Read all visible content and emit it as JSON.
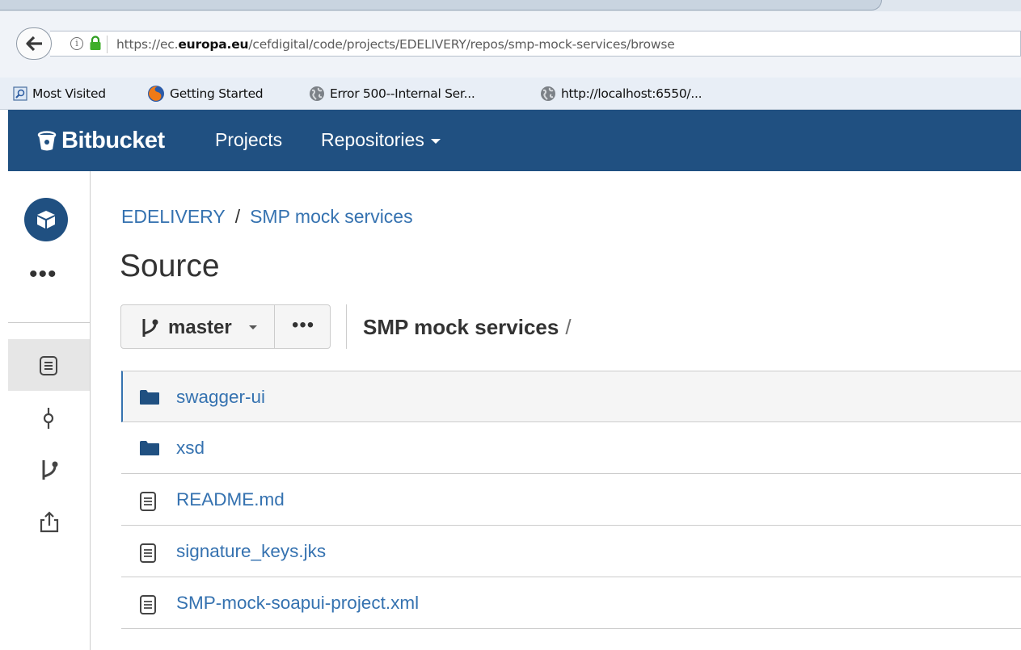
{
  "browser": {
    "url_prefix": "https://ec.",
    "url_domain": "europa.eu",
    "url_path": "/cefdigital/code/projects/EDELIVERY/repos/smp-mock-services/browse",
    "bookmarks": [
      {
        "label": "Most Visited",
        "icon": "bookmark-folder-icon"
      },
      {
        "label": "Getting Started",
        "icon": "firefox-icon"
      },
      {
        "label": "Error 500--Internal Ser...",
        "icon": "globe-icon"
      },
      {
        "label": "http://localhost:6550/...",
        "icon": "globe-icon"
      }
    ]
  },
  "header": {
    "logo": "Bitbucket",
    "nav": {
      "projects": "Projects",
      "repositories": "Repositories"
    }
  },
  "breadcrumb": {
    "project": "EDELIVERY",
    "separator": "/",
    "repo": "SMP mock services"
  },
  "page": {
    "title": "Source"
  },
  "branch": {
    "name": "master",
    "more": "•••"
  },
  "path": {
    "repo": "SMP mock services",
    "slash": "/"
  },
  "sidebar": {
    "more": "•••",
    "items": [
      {
        "name": "source",
        "icon": "source-file-icon",
        "active": true
      },
      {
        "name": "commits",
        "icon": "commit-icon"
      },
      {
        "name": "branches",
        "icon": "branch-icon"
      },
      {
        "name": "pull-requests",
        "icon": "share-upload-icon"
      }
    ]
  },
  "files": [
    {
      "name": "swagger-ui",
      "type": "folder"
    },
    {
      "name": "xsd",
      "type": "folder"
    },
    {
      "name": "README.md",
      "type": "file"
    },
    {
      "name": "signature_keys.jks",
      "type": "file"
    },
    {
      "name": "SMP-mock-soapui-project.xml",
      "type": "file"
    }
  ],
  "colors": {
    "brand": "#205081",
    "link": "#3572b0",
    "text": "#333333",
    "border": "#cccccc"
  }
}
